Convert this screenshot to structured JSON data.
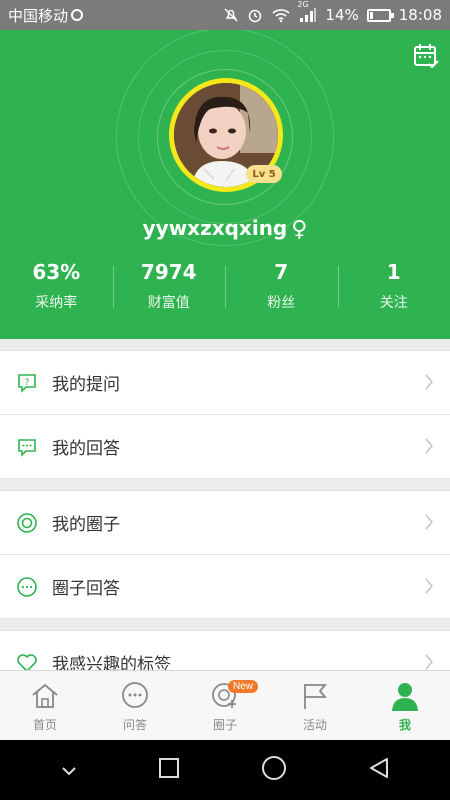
{
  "status_bar": {
    "carrier": "中国移动",
    "network": "2G",
    "battery_percent": "14%",
    "battery_level": 0.14,
    "time": "18:08"
  },
  "profile": {
    "username": "yywxzxqxing",
    "gender_symbol": "♀",
    "level": "Lv 5",
    "accent_color": "#2fb350",
    "avatar_ring_color": "#f4e71a"
  },
  "stats": [
    {
      "value": "63%",
      "label": "采纳率"
    },
    {
      "value": "7974",
      "label": "财富值"
    },
    {
      "value": "7",
      "label": "粉丝"
    },
    {
      "value": "1",
      "label": "关注"
    }
  ],
  "menu": {
    "my_questions": "我的提问",
    "my_answers": "我的回答",
    "my_circles": "我的圈子",
    "circle_answers": "圈子回答",
    "interested_tags": "我感兴趣的标签"
  },
  "tabs": [
    {
      "label": "首页",
      "icon": "home-icon"
    },
    {
      "label": "问答",
      "icon": "chat-icon"
    },
    {
      "label": "圈子",
      "icon": "circle-add-icon",
      "badge": "New"
    },
    {
      "label": "活动",
      "icon": "flag-icon"
    },
    {
      "label": "我",
      "icon": "user-icon"
    }
  ]
}
